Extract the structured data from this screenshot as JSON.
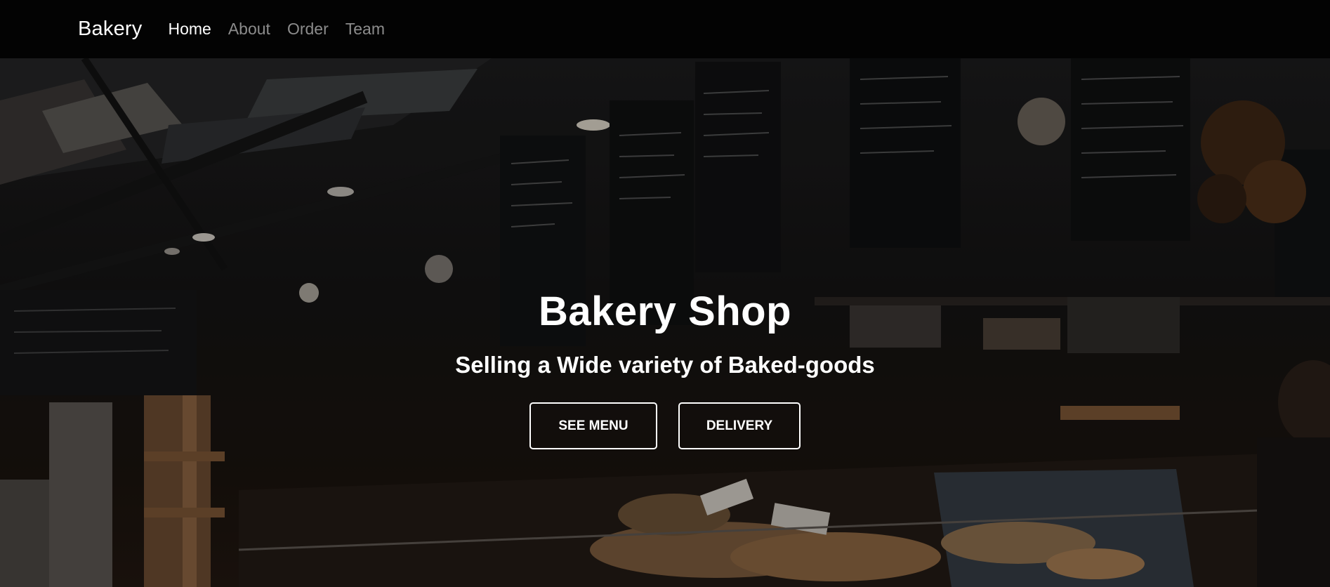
{
  "navbar": {
    "brand": "Bakery",
    "links": [
      {
        "label": "Home",
        "active": true
      },
      {
        "label": "About",
        "active": false
      },
      {
        "label": "Order",
        "active": false
      },
      {
        "label": "Team",
        "active": false
      }
    ]
  },
  "hero": {
    "title": "Bakery Shop",
    "subtitle": "Selling a Wide variety of Baked-goods",
    "buttons": {
      "menu_label": "SEE MENU",
      "delivery_label": "DELIVERY"
    },
    "background_image": "bakery shop interior with chalkboard menus and pastry display case"
  },
  "colors": {
    "navbar_bg": "#030303",
    "nav_active": "#ffffff",
    "nav_inactive": "#8c8c8c",
    "text": "#ffffff"
  }
}
